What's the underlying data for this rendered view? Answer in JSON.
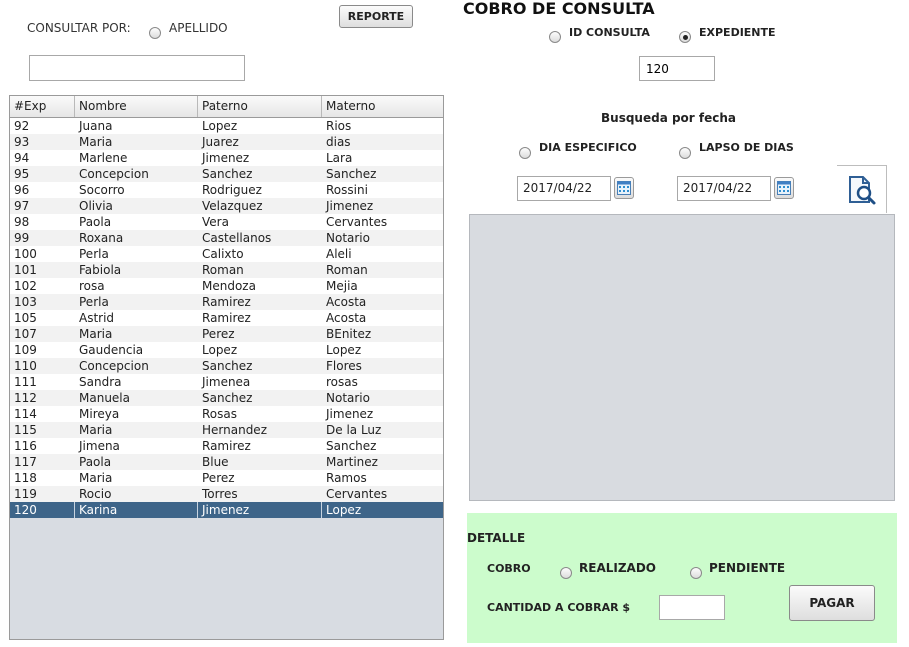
{
  "filter": {
    "consultar_por_label": "CONSULTAR POR:",
    "apellido_label": "APELLIDO",
    "search_value": "",
    "reporte_label": "REPORTE"
  },
  "header": {
    "title": "COBRO DE CONSULTA",
    "id_consulta_label": "ID CONSULTA",
    "expediente_label": "EXPEDIENTE",
    "expediente_value": "120"
  },
  "date_search": {
    "title": "Busqueda por fecha",
    "dia_especifico_label": "DIA ESPECIFICO",
    "lapso_dias_label": "LAPSO DE DIAS",
    "date1": "2017/04/22",
    "date2": "2017/04/22"
  },
  "table": {
    "columns": [
      "#Exp",
      "Nombre",
      "Paterno",
      "Materno"
    ],
    "rows": [
      [
        "92",
        "Juana",
        "Lopez",
        "Rios"
      ],
      [
        "93",
        "Maria",
        "Juarez",
        "dias"
      ],
      [
        "94",
        "Marlene",
        "Jimenez",
        "Lara"
      ],
      [
        "95",
        "Concepcion",
        "Sanchez",
        "Sanchez"
      ],
      [
        "96",
        "Socorro",
        "Rodriguez",
        "Rossini"
      ],
      [
        "97",
        "Olivia",
        "Velazquez",
        "Jimenez"
      ],
      [
        "98",
        "Paola",
        "Vera",
        "Cervantes"
      ],
      [
        "99",
        "Roxana",
        "Castellanos",
        "Notario"
      ],
      [
        "100",
        "Perla",
        "Calixto",
        "Aleli"
      ],
      [
        "101",
        "Fabiola",
        "Roman",
        "Roman"
      ],
      [
        "102",
        "rosa",
        "Mendoza",
        "Mejia"
      ],
      [
        "103",
        "Perla",
        "Ramirez",
        "Acosta"
      ],
      [
        "105",
        "Astrid",
        "Ramirez",
        "Acosta"
      ],
      [
        "107",
        "Maria",
        "Perez",
        "BEnitez"
      ],
      [
        "109",
        "Gaudencia",
        "Lopez",
        "Lopez"
      ],
      [
        "110",
        "Concepcion",
        "Sanchez",
        "Flores"
      ],
      [
        "111",
        "Sandra",
        "Jimenea",
        "rosas"
      ],
      [
        "112",
        "Manuela",
        "Sanchez",
        "Notario"
      ],
      [
        "114",
        "Mireya",
        "Rosas",
        "Jimenez"
      ],
      [
        "115",
        "Maria",
        "Hernandez",
        "De la Luz"
      ],
      [
        "116",
        "Jimena",
        "Ramirez",
        "Sanchez"
      ],
      [
        "117",
        "Paola",
        "Blue",
        "Martinez"
      ],
      [
        "118",
        "Maria",
        "Perez",
        "Ramos"
      ],
      [
        "119",
        "Rocio",
        "Torres",
        "Cervantes"
      ],
      [
        "120",
        "Karina",
        "Jimenez",
        "Lopez"
      ]
    ],
    "selected_exp": "120"
  },
  "detalle": {
    "title": "DETALLE",
    "cobro_label": "COBRO",
    "realizado_label": "REALIZADO",
    "pendiente_label": "PENDIENTE",
    "cantidad_label": "CANTIDAD A COBRAR $",
    "cantidad_value": "",
    "pagar_label": "PAGAR"
  },
  "colors": {
    "selected_row": "#3e6589",
    "detalle_bg": "#ccfccc",
    "panel_gray": "#d8dbe0"
  }
}
